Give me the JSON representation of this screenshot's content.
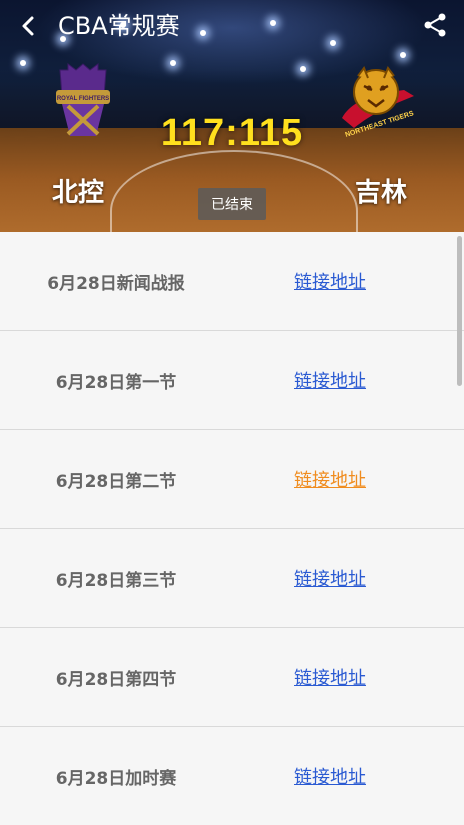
{
  "header": {
    "title": "CBA常规赛",
    "back_icon": "back-arrow-icon",
    "share_icon": "share-icon"
  },
  "match": {
    "home_team": "北控",
    "away_team": "吉林",
    "score": "117:115",
    "status": "已结束",
    "home_logo": "royal-fighters-logo",
    "home_logo_text": "ROYAL FIGHTERS",
    "away_logo": "northeast-tigers-logo",
    "away_logo_text": "NORTHEAST TIGERS",
    "score_color": "#ffe01e"
  },
  "links": [
    {
      "label": "6月28日新闻战报",
      "link_text": "链接地址",
      "link_color": "#2a5ad2"
    },
    {
      "label": "6月28日第一节",
      "link_text": "链接地址",
      "link_color": "#2a5ad2"
    },
    {
      "label": "6月28日第二节",
      "link_text": "链接地址",
      "link_color": "#f08c1e"
    },
    {
      "label": "6月28日第三节",
      "link_text": "链接地址",
      "link_color": "#2a5ad2"
    },
    {
      "label": "6月28日第四节",
      "link_text": "链接地址",
      "link_color": "#2a5ad2"
    },
    {
      "label": "6月28日加时赛",
      "link_text": "链接地址",
      "link_color": "#2a5ad2"
    }
  ]
}
